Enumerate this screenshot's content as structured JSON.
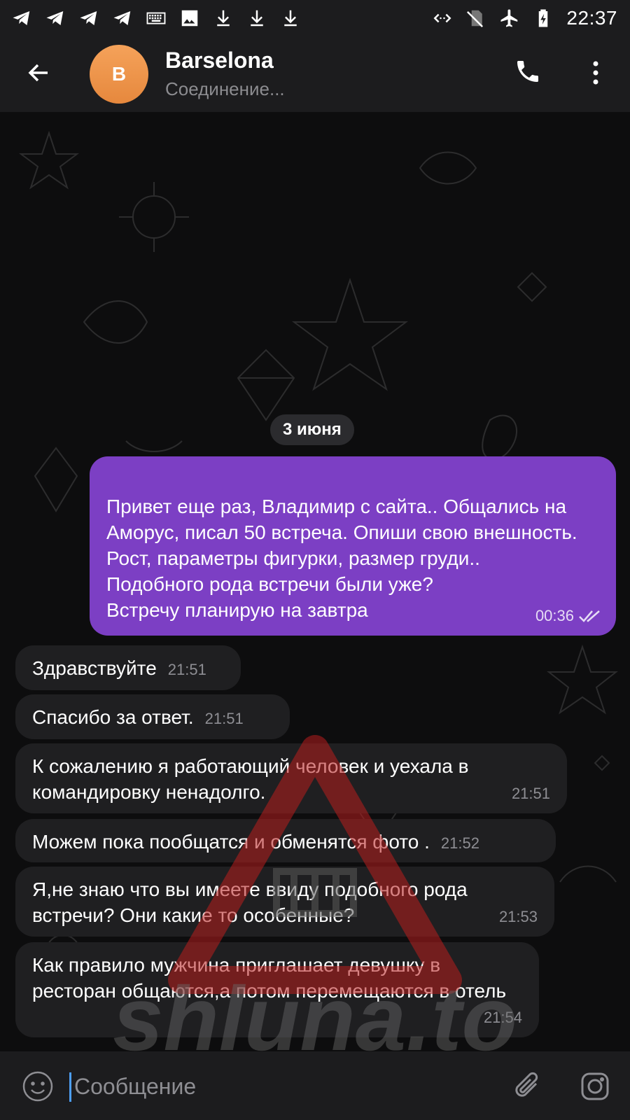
{
  "status_bar": {
    "time": "22:37",
    "left_icons": [
      "telegram-icon",
      "telegram-icon",
      "telegram-icon",
      "telegram-icon",
      "keyboard-icon",
      "image-icon",
      "download-icon",
      "download-icon",
      "download-icon"
    ],
    "right_icons": [
      "code-arrows-icon",
      "no-sim-icon",
      "airplane-icon",
      "battery-charging-icon"
    ]
  },
  "header": {
    "title": "Barselona",
    "status": "Соединение...",
    "avatar_letter": "B",
    "avatar_color": "#eb9248"
  },
  "chat": {
    "date": "3 июня",
    "outgoing": {
      "text": "Привет еще раз, Владимир с сайта.. Общались на Аморус, писал 50 встреча. Опиши свою внешность. Рост, параметры фигурки, размер груди..\nПодобного рода встречи были уже?\nВстречу планирую на завтра",
      "time": "00:36",
      "color": "#7c3fc4"
    },
    "incoming": [
      {
        "text": "Здравствуйте",
        "time": "21:51"
      },
      {
        "text": "Спасибо  за ответ.",
        "time": "21:51"
      },
      {
        "text": "К  сожалению я работающий человек  и уехала в командировку  ненадолго.",
        "time": "21:51"
      },
      {
        "text": "Можем пока пообщатся и обменятся фото .",
        "time": "21:52"
      },
      {
        "text": "Я,не знаю что вы имеете ввиду  подобного рода встречи? Они какие то особенные?",
        "time": "21:53"
      },
      {
        "text": "Как правило мужчина приглашает девушку в ресторан  общаются,а потом перемещаются в отель",
        "time": "21:54"
      }
    ]
  },
  "watermark": {
    "text": "shluna.to"
  },
  "input": {
    "placeholder": "Сообщение",
    "value": ""
  }
}
